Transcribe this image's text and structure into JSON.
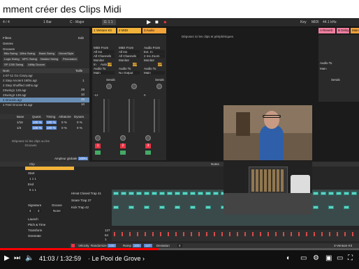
{
  "video": {
    "title": "mment créer des Clips Midi",
    "time": "41:03 / 1:32:59",
    "chapter": "· Le Pool de Grove ›",
    "progress": 0.441
  },
  "toolbar": {
    "bpm": "4 / 4",
    "bar": "1 Bar",
    "key": "C - Major",
    "position": "11 1 1",
    "key_btn": "Key",
    "midi": "MIDI",
    "cpu": "44.1 kHz"
  },
  "browser": {
    "filter_label": "Filtres",
    "edit_label": "Edit",
    "genres_label": "Genres",
    "grooves_label": "Grooves",
    "chips": [
      "Bitu Swing",
      "16ths Swing",
      "Basic Swing",
      "Genre/Style",
      "Logic Swing",
      "MPC Swing",
      "Notator Swing",
      "Percussion",
      "SP 1200 Swing",
      "Utility Groove"
    ],
    "col_name": "Nom",
    "col_size": "Taille",
    "files": [
      {
        "name": "1-07-11 Go Crazy.agr",
        "size": ""
      },
      {
        "name": "2 Step Ancient 16ths.agr",
        "size": "1"
      },
      {
        "name": "2 Step Shuffled 16ths.agr",
        "size": ""
      },
      {
        "name": "2Swing1 126.agr",
        "size": "29"
      },
      {
        "name": "2Swing2 130.agr",
        "size": "10"
      },
      {
        "name": "4 Groovin.agr",
        "size": "38"
      },
      {
        "name": "4 Feel Groove 91.agr",
        "size": "10"
      }
    ],
    "pool_headers": [
      "Base",
      "Quant.",
      "Timing",
      "Aléatoire",
      "Dynam."
    ],
    "pool_rows": [
      {
        "base": "1/16",
        "quant": "100 %",
        "timing": "100 %",
        "rand": "0 %",
        "dyn": "0 %"
      },
      {
        "base": "1/4",
        "quant": "100 %",
        "timing": "100 %",
        "rand": "0 %",
        "dyn": "0 %"
      }
    ],
    "drop_hint": "Déposez ici les clips ou les Grooves",
    "amount_label": "Ampleur globale",
    "amount_value": "100%"
  },
  "tracks": [
    {
      "name": "1 Venture Kit",
      "color": "#f2b33a"
    },
    {
      "name": "2 MIDI",
      "color": "#f2b33a"
    },
    {
      "name": "3 Audio",
      "color": "#f2a33a"
    }
  ],
  "returns": [
    {
      "name": "A Reverb",
      "color": "#f27fa0"
    },
    {
      "name": "B Delay",
      "color": "#f27fa0"
    },
    {
      "name": "Main",
      "color": "#f2a33a"
    }
  ],
  "track_labels": {
    "midi_from": "MIDI From",
    "all_ins": "All Ins",
    "all_channels": "All Channels",
    "monitor": "Monitor",
    "in": "In",
    "auto": "Auto",
    "off": "Off",
    "audio_to": "Audio To",
    "main": "Main",
    "no_output": "No Output",
    "audio_from": "Audio From",
    "ext_in": "Ext. In",
    "input_2": "2 ms Zoom",
    "sends": "Sends",
    "vol_1": "-12",
    "vol_2": "-inf",
    "vol_3": "0",
    "numbers": [
      "1",
      "2",
      "3"
    ]
  },
  "session_hint": "Déposez ici les clips et périphériques",
  "clip": {
    "header": "Clip",
    "start_label": "Start",
    "end_label": "End",
    "signature_label": "Signature",
    "groove_label": "Groove",
    "groove_value": "None",
    "sig_num": "4",
    "sig_den": "4",
    "start_value": "1 1 1",
    "end_value": "5 1 1",
    "launch": "Launch",
    "pitch": "Pitch & Time",
    "transform": "Transform",
    "generate": "Generate",
    "notes_label": "Notes",
    "lanes": [
      "HiHat Closed Trap 41",
      "Snare Trap 37",
      "Kick Trap 42"
    ],
    "velocity_values": [
      "127",
      "64",
      "1"
    ],
    "footer": {
      "velocity": "Velocity",
      "random": "Randomize",
      "value1": "100",
      "ramp": "Ramp",
      "value2": "100",
      "value3": "127",
      "deviation": "Deviation",
      "value4": "0"
    },
    "track_ref": "3-Venture Kit"
  }
}
